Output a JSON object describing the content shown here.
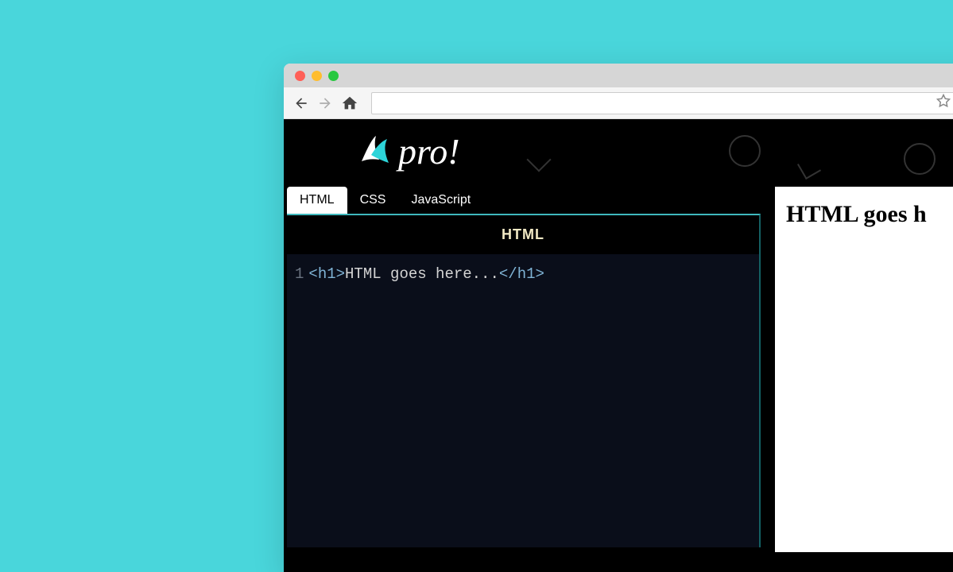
{
  "logo": {
    "text": "pro!"
  },
  "tabs": [
    {
      "label": "HTML",
      "active": true
    },
    {
      "label": "CSS",
      "active": false
    },
    {
      "label": "JavaScript",
      "active": false
    }
  ],
  "editor": {
    "title": "HTML",
    "line_number": "1",
    "open_bracket": "<",
    "open_tag": "h1",
    "close_open_bracket": ">",
    "content": "HTML goes here...",
    "close_bracket_start": "</",
    "close_tag": "h1",
    "close_bracket_end": ">"
  },
  "preview": {
    "heading": "HTML goes h"
  }
}
